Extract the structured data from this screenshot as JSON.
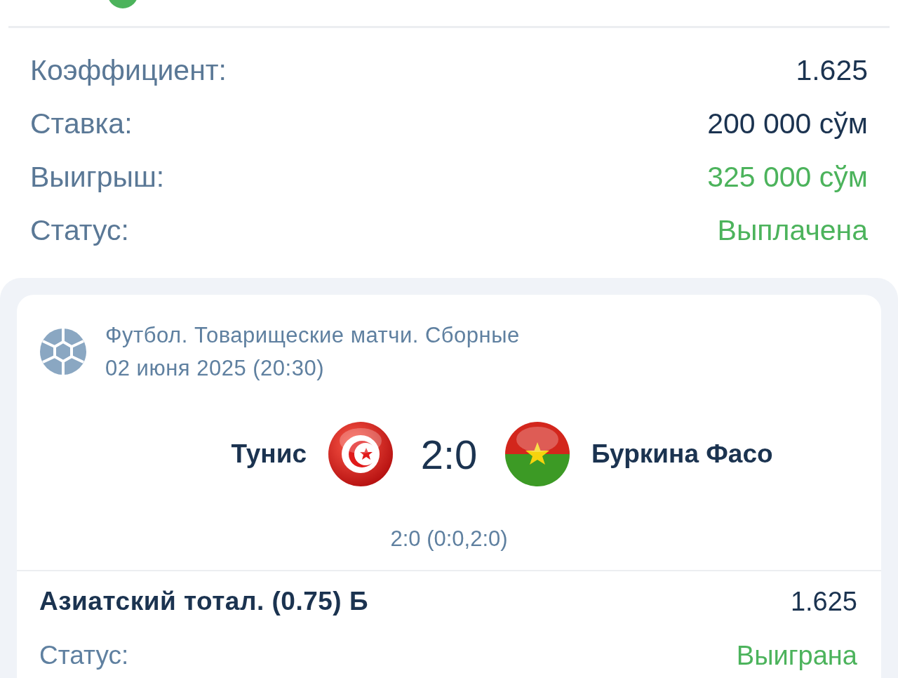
{
  "summary": [
    {
      "label": "Коэффициент:",
      "value": "1.625",
      "kind": "plain"
    },
    {
      "label": "Ставка:",
      "value": "200 000 сўм",
      "kind": "plain"
    },
    {
      "label": "Выигрыш:",
      "value": "325 000 сўм",
      "kind": "positive"
    },
    {
      "label": "Статус:",
      "value": "Выплачена",
      "kind": "positive"
    }
  ],
  "event": {
    "sport": "Футбол. Товарищеские матчи. Сборные",
    "date": "02 июня 2025 (20:30)",
    "home": "Тунис",
    "score": "2:0",
    "away": "Буркина Фасо",
    "score_detail": "2:0 (0:0,2:0)"
  },
  "bet": {
    "market": "Азиатский тотал. (0.75) Б",
    "odds": "1.625",
    "status_label": "Статус:",
    "status": "Выиграна",
    "kind": "positive"
  }
}
